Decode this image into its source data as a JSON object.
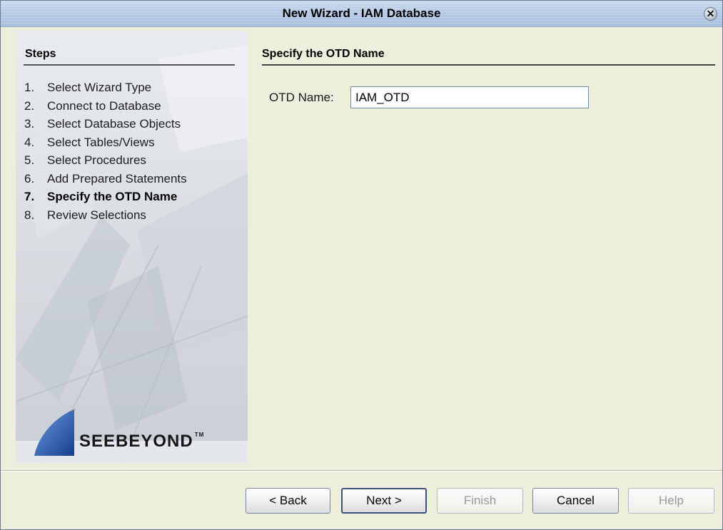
{
  "window": {
    "title": "New Wizard - IAM Database",
    "close_icon": "close-icon"
  },
  "steps": {
    "heading": "Steps",
    "items": [
      {
        "num": "1.",
        "label": "Select Wizard Type"
      },
      {
        "num": "2.",
        "label": "Connect to Database"
      },
      {
        "num": "3.",
        "label": "Select Database Objects"
      },
      {
        "num": "4.",
        "label": "Select Tables/Views"
      },
      {
        "num": "5.",
        "label": "Select Procedures"
      },
      {
        "num": "6.",
        "label": "Add Prepared Statements"
      },
      {
        "num": "7.",
        "label": "Specify the OTD Name"
      },
      {
        "num": "8.",
        "label": "Review Selections"
      }
    ],
    "active_index": 6,
    "logo_text": "SeeBeyond"
  },
  "content": {
    "heading": "Specify the OTD Name",
    "otd_name_label": "OTD Name:",
    "otd_name_value": "IAM_OTD"
  },
  "buttons": {
    "back": "< Back",
    "next": "Next >",
    "finish": "Finish",
    "cancel": "Cancel",
    "help": "Help"
  },
  "colors": {
    "window_bg": "#eeeedd",
    "title_bar": "#b8cce6",
    "logo_blue": "#1f4fa0"
  }
}
